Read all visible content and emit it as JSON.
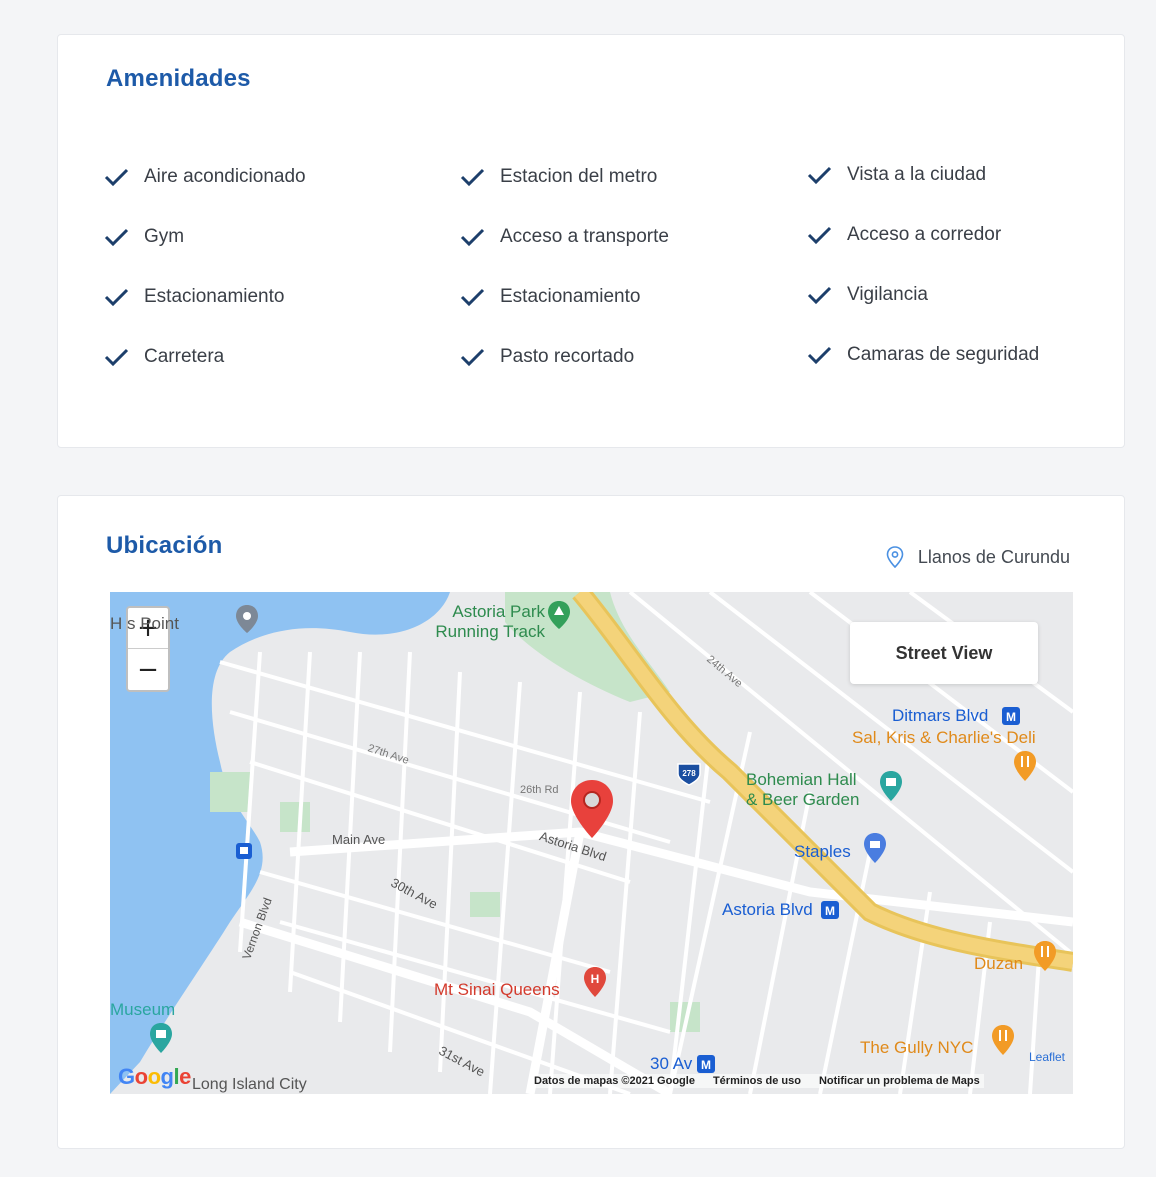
{
  "amenities": {
    "title": "Amenidades",
    "columns": [
      [
        "Aire acondicionado",
        "Gym",
        "Estacionamiento",
        "Carretera"
      ],
      [
        "Estacion del metro",
        "Acceso a transporte",
        "Estacionamiento",
        "Pasto recortado"
      ],
      [
        "Vista a la ciudad",
        "Acceso a corredor",
        "Vigilancia",
        "Camaras de seguridad"
      ]
    ],
    "check_color": "#1d3f6b"
  },
  "location": {
    "title": "Ubicación",
    "place": "Llanos de Curundu",
    "map": {
      "zoom_in": "+",
      "zoom_out": "−",
      "street_view": "Street View",
      "labels": {
        "hallets_point": "H  s Point",
        "astoria_park": "Astoria Park\nRunning Track",
        "ditmars": "Ditmars Blvd",
        "sal_kris": "Sal, Kris & Charlie's Deli",
        "bohemian": "Bohemian Hall\n& Beer Garden",
        "staples": "Staples",
        "astoria_blvd_station": "Astoria Blvd",
        "duzan": "Duzan",
        "mt_sinai": "Mt Sinai Queens",
        "the_gully": "The Gully NYC",
        "thirty_av": "30 Av",
        "museum": "Museum",
        "lic": "Long Island City",
        "leaflet": "Leaflet",
        "main_ave": "Main Ave",
        "astoria_blvd": "Astoria Blvd",
        "thirtieth_ave": "30th Ave",
        "twentyseventh_ave": "27th Ave",
        "vernon_blvd": "Vernon Blvd",
        "thirtyfirst_ave": "31st Ave",
        "twentysixth_rd": "26th Rd",
        "twentyfourth_ave": "24th Ave",
        "shield": "278"
      },
      "footer": {
        "data": "Datos de mapas ©2021 Google",
        "terms": "Términos de uso",
        "report": "Notificar un problema de Maps"
      },
      "google": "Google"
    }
  },
  "colors": {
    "title": "#1d5aa8",
    "highway": "#f4d37a",
    "water": "#8fc2f2",
    "park": "#c6e4c9",
    "pin": "#e8413c"
  }
}
